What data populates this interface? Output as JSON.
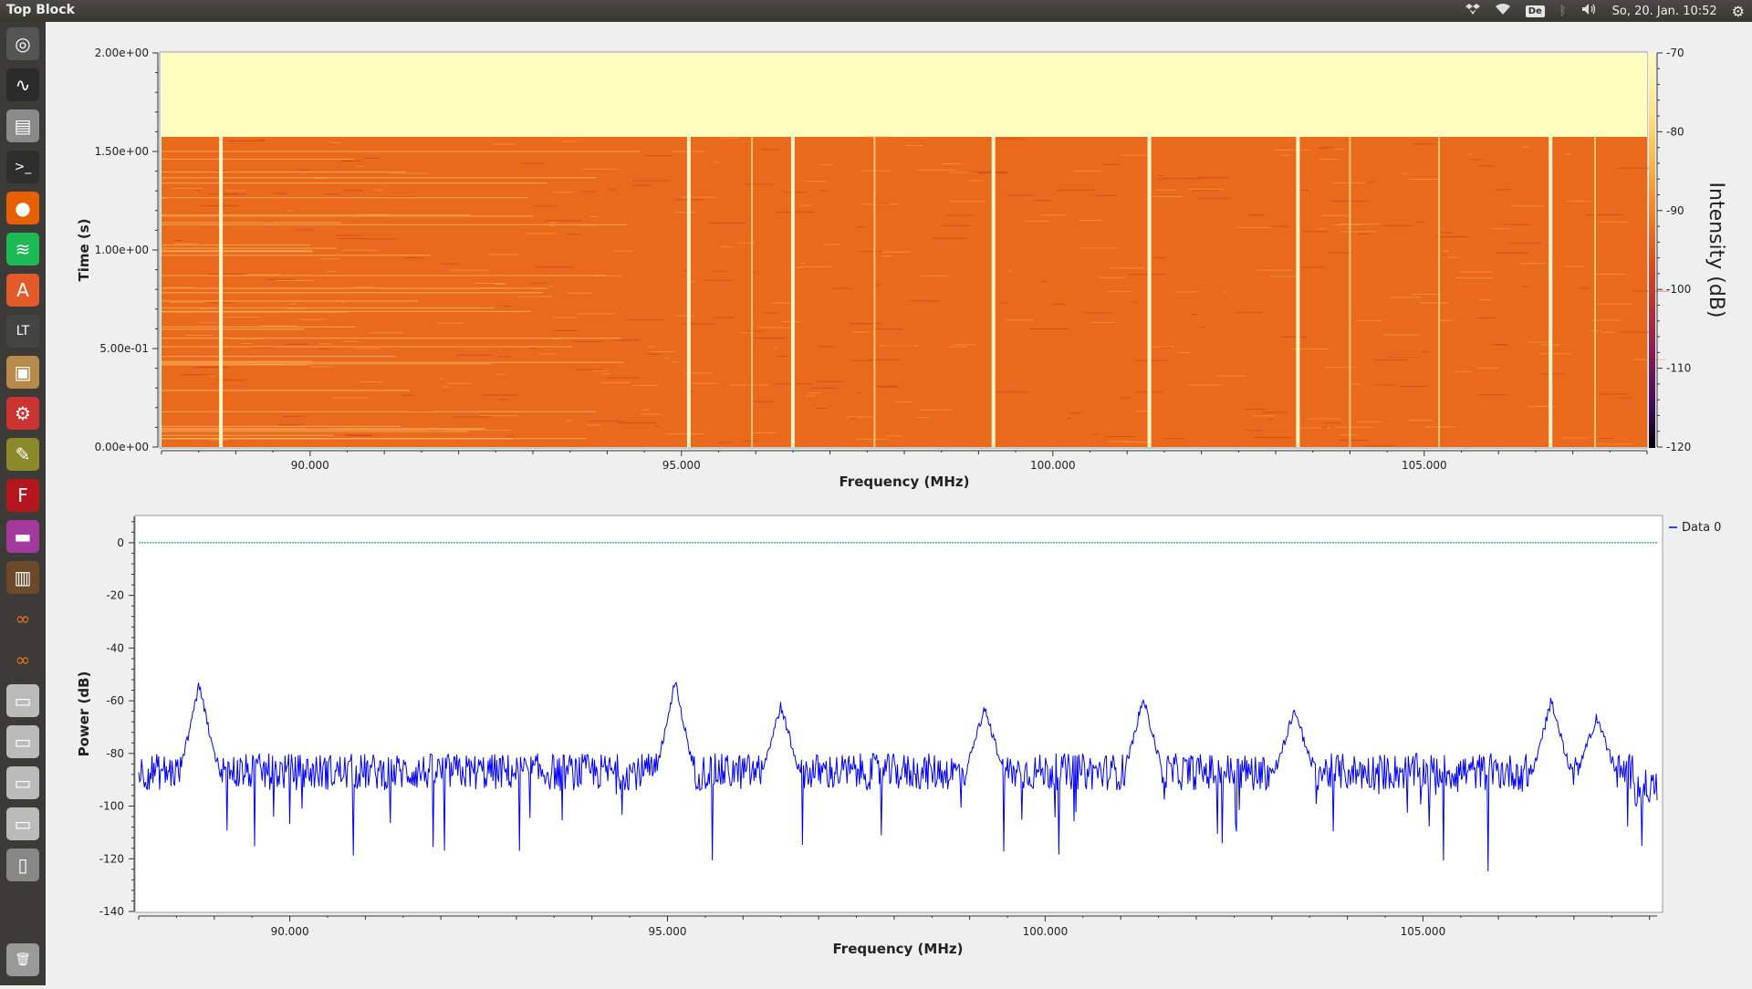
{
  "window": {
    "title": "Top Block"
  },
  "tray": {
    "keyboard": "De",
    "datetime": "So, 20. Jan. 10:52",
    "icons": [
      "dropbox-icon",
      "wifi-icon",
      "keyboard-layout-icon",
      "bluetooth-icon",
      "volume-icon",
      "settings-gear-icon"
    ]
  },
  "launcher": {
    "icons": [
      "ubuntu-dash-icon",
      "system-monitor-icon",
      "file-manager-icon",
      "terminal-icon",
      "firefox-icon",
      "spotify-icon",
      "software-center-icon",
      "ltspice-icon",
      "archive-manager-icon",
      "settings-tool-icon",
      "gimp-icon",
      "filezilla-icon",
      "grc-window-icon",
      "bookshelf-icon",
      "gnuradio-companion-icon",
      "gnuradio-companion-icon",
      "drive-icon",
      "drive-icon",
      "drive-icon",
      "drive-icon",
      "usb-drive-icon",
      "trash-icon"
    ]
  },
  "chart_data": [
    {
      "type": "heatmap",
      "title": "",
      "xlabel": "Frequency (MHz)",
      "ylabel": "Time (s)",
      "xlim": [
        88.0,
        108.0
      ],
      "ylim": [
        0.0,
        2.0
      ],
      "xticks": [
        "90.000",
        "95.000",
        "100.000",
        "105.000"
      ],
      "yticks": [
        "0.00e+00",
        "5.00e-01",
        "1.00e+00",
        "1.50e+00",
        "2.00e+00"
      ],
      "colorbar": {
        "label": "Intensity (dB)",
        "range": [
          -120,
          -70
        ],
        "ticks": [
          "-70",
          "-80",
          "-90",
          "-100",
          "-110",
          "-120"
        ]
      },
      "filled_time_max": 1.58,
      "strong_carriers_mhz": [
        88.8,
        95.1,
        96.5,
        99.2,
        101.3,
        103.3,
        106.7
      ],
      "weak_carriers_mhz": [
        95.95,
        97.6,
        104.0,
        105.2,
        107.3
      ],
      "background_db": -85
    },
    {
      "type": "line",
      "title": "",
      "xlabel": "Frequency (MHz)",
      "ylabel": "Power (dB)",
      "xlim": [
        88.0,
        108.1
      ],
      "ylim": [
        -140,
        10
      ],
      "xticks": [
        "90.000",
        "95.000",
        "100.000",
        "105.000"
      ],
      "yticks": [
        "0",
        "-20",
        "-40",
        "-60",
        "-80",
        "-100",
        "-120",
        "-140"
      ],
      "legend": "top-right",
      "series": [
        {
          "name": "Data 0",
          "color": "#0000ff",
          "noise_floor_db": -87
        }
      ],
      "reference_line": {
        "value": 0,
        "color": "#008b8b"
      },
      "peaks": [
        {
          "f": 88.8,
          "db": -54
        },
        {
          "f": 95.1,
          "db": -53
        },
        {
          "f": 96.5,
          "db": -62
        },
        {
          "f": 99.2,
          "db": -63
        },
        {
          "f": 101.3,
          "db": -59
        },
        {
          "f": 103.3,
          "db": -63
        },
        {
          "f": 106.7,
          "db": -60
        },
        {
          "f": 107.3,
          "db": -66
        }
      ]
    }
  ]
}
